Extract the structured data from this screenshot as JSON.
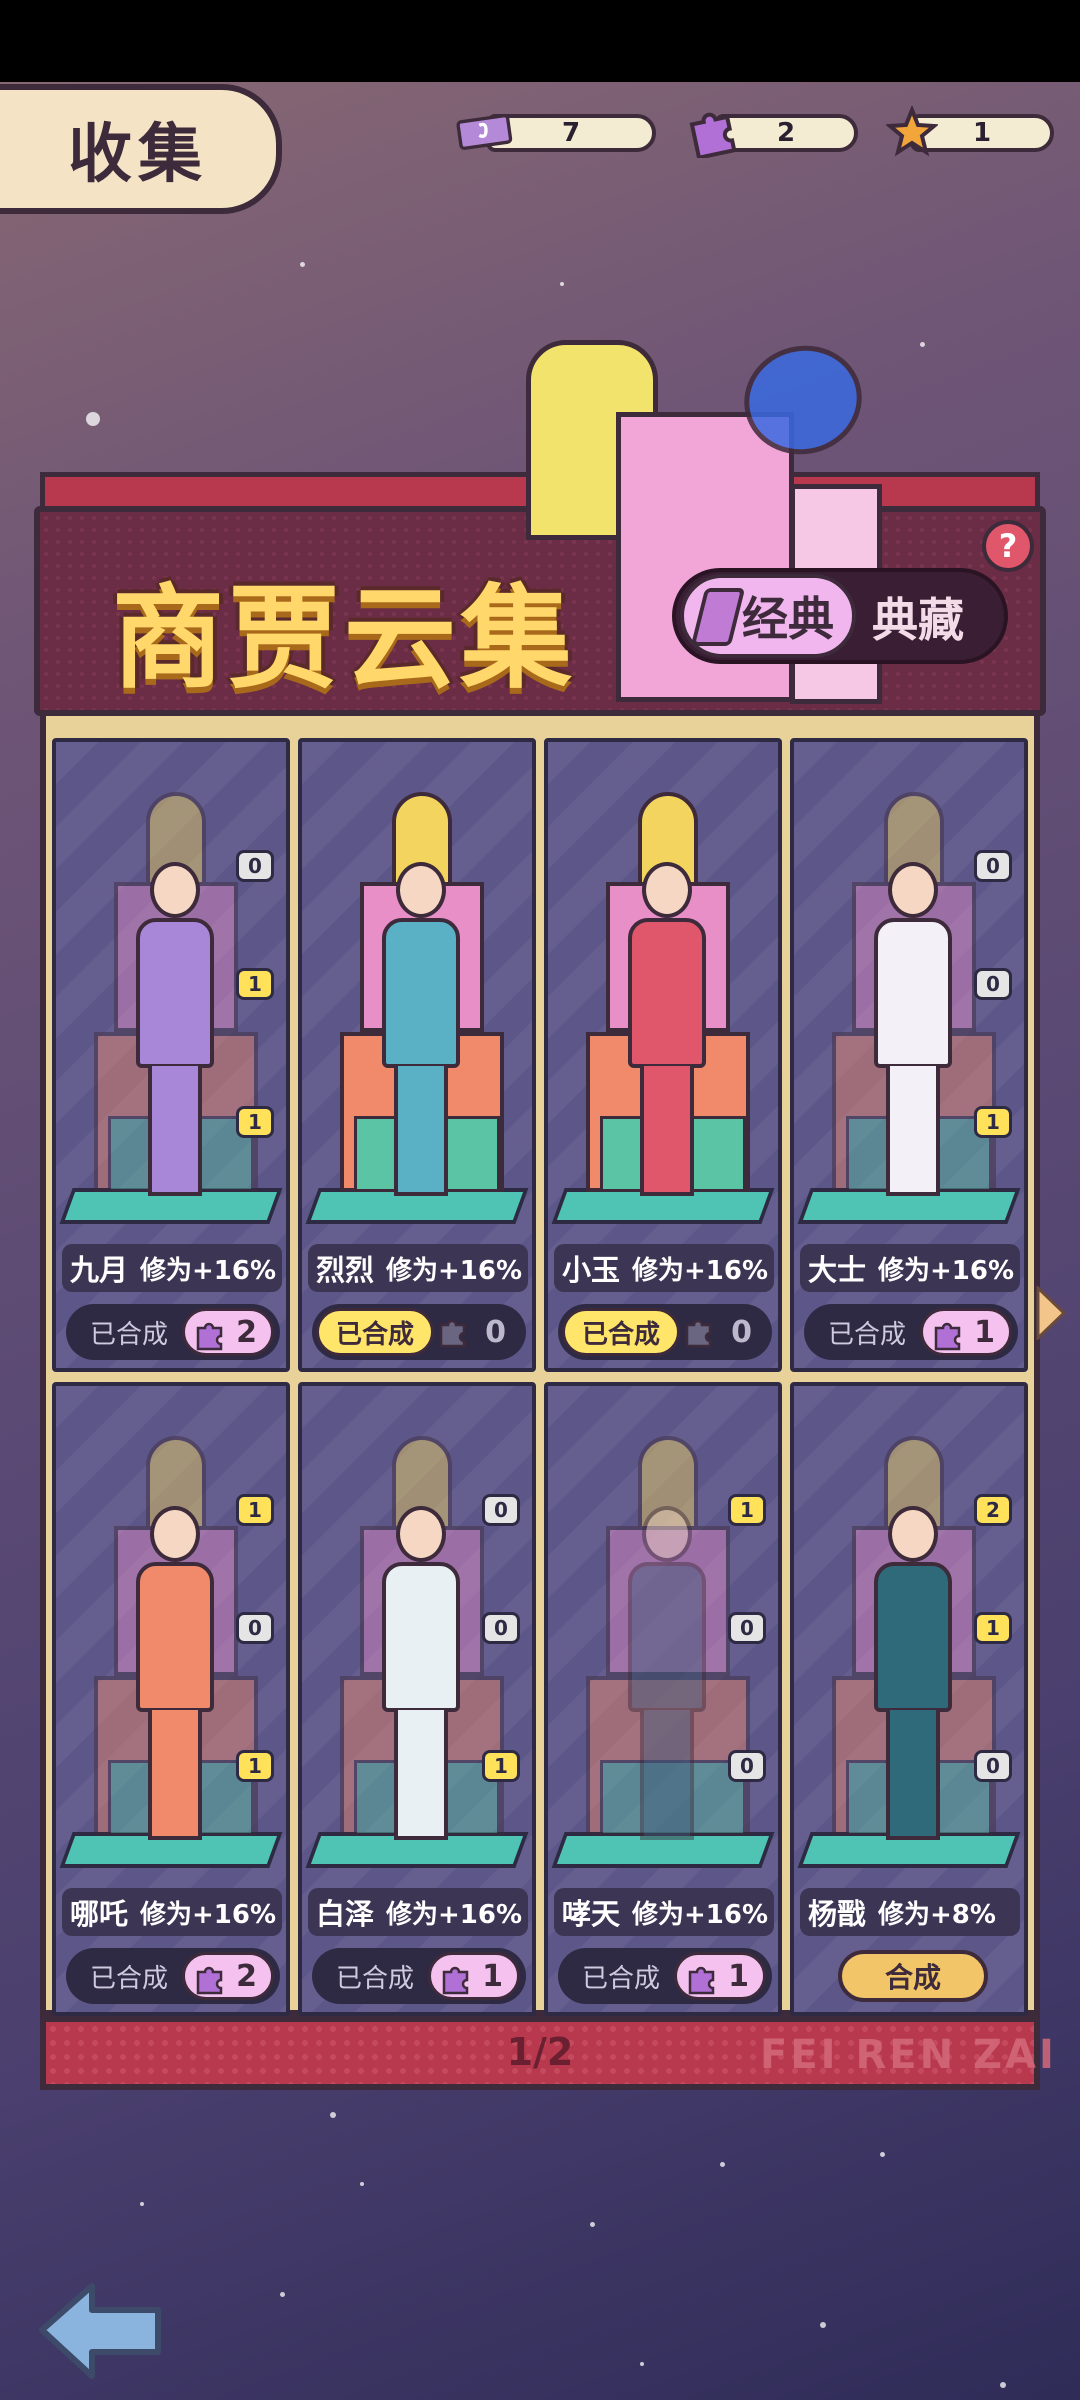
{
  "header": {
    "title": "收集"
  },
  "currencies": [
    {
      "icon": "ticket-icon",
      "value": "7",
      "color": "#b48ad8"
    },
    {
      "icon": "puzzle-piece-icon",
      "value": "2",
      "color": "#b070d6"
    },
    {
      "icon": "star-icon",
      "value": "1",
      "color": "#f2a53a"
    }
  ],
  "banner": {
    "title": "商贾云集",
    "tab_classic": "经典",
    "tab_collection": "典藏",
    "help": "?"
  },
  "cards": [
    {
      "name": "九月",
      "bonus": "修为+16%",
      "counts": [
        "0",
        "1",
        "1"
      ],
      "count_states": [
        "off",
        "on",
        "on"
      ],
      "status": "已合成",
      "completed": false,
      "pieces": "2",
      "has_pieces": true,
      "outfit": "#a987d8"
    },
    {
      "name": "烈烈",
      "bonus": "修为+16%",
      "counts": [],
      "count_states": [],
      "status": "已合成",
      "completed": true,
      "pieces": "0",
      "has_pieces": false,
      "outfit": "#5ab0c4"
    },
    {
      "name": "小玉",
      "bonus": "修为+16%",
      "counts": [],
      "count_states": [],
      "status": "已合成",
      "completed": true,
      "pieces": "0",
      "has_pieces": false,
      "outfit": "#e0566a"
    },
    {
      "name": "大士",
      "bonus": "修为+16%",
      "counts": [
        "0",
        "0",
        "1"
      ],
      "count_states": [
        "off",
        "off",
        "on"
      ],
      "status": "已合成",
      "completed": false,
      "pieces": "1",
      "has_pieces": true,
      "outfit": "#f4f0f8"
    },
    {
      "name": "哪吒",
      "bonus": "修为+16%",
      "counts": [
        "1",
        "0",
        "1"
      ],
      "count_states": [
        "on",
        "off",
        "on"
      ],
      "status": "已合成",
      "completed": false,
      "pieces": "2",
      "has_pieces": true,
      "outfit": "#f08a6a"
    },
    {
      "name": "白泽",
      "bonus": "修为+16%",
      "counts": [
        "0",
        "0",
        "1"
      ],
      "count_states": [
        "off",
        "off",
        "on"
      ],
      "status": "已合成",
      "completed": false,
      "pieces": "1",
      "has_pieces": true,
      "outfit": "#e8f0f4"
    },
    {
      "name": "哮天",
      "bonus": "修为+16%",
      "counts": [
        "1",
        "0",
        "0"
      ],
      "count_states": [
        "on",
        "off",
        "off"
      ],
      "status": "已合成",
      "completed": false,
      "pieces": "1",
      "has_pieces": true,
      "outfit": "#3d5a7a"
    },
    {
      "name": "杨戬",
      "bonus": "修为+8%",
      "counts": [
        "2",
        "1",
        "0"
      ],
      "count_states": [
        "on",
        "on",
        "off"
      ],
      "status": "",
      "completed": false,
      "pieces": "",
      "has_pieces": false,
      "synth_button": "合成",
      "outfit": "#2f6a7a"
    }
  ],
  "pager": {
    "indicator": "1/2",
    "watermark": "FEI REN ZAI"
  },
  "nav": {
    "back_icon": "back-arrow-icon",
    "next_icon": "chevron-right-icon"
  }
}
